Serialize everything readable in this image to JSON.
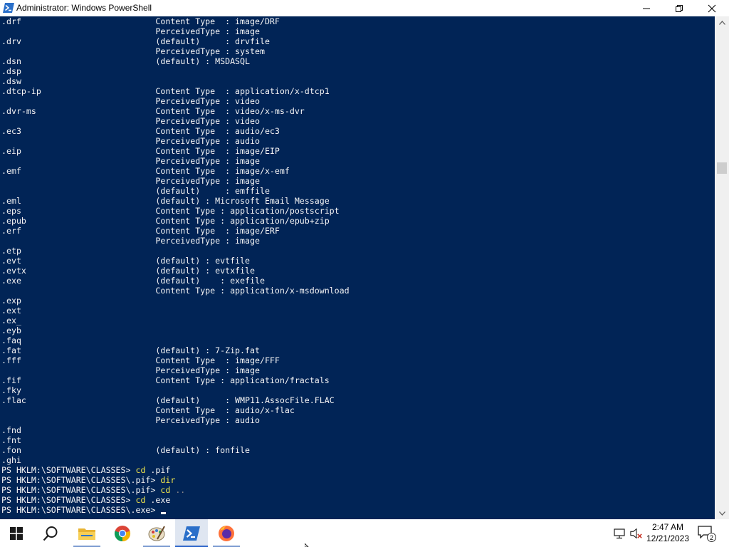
{
  "window": {
    "title": "Administrator: Windows PowerShell",
    "icon": "powershell-icon",
    "controls": [
      "minimize-icon",
      "restore-icon",
      "close-icon"
    ]
  },
  "console": {
    "output_lines": [
      ".drf                           Content Type  : image/DRF",
      "                               PerceivedType : image",
      ".drv                           (default)     : drvfile",
      "                               PerceivedType : system",
      ".dsn                           (default) : MSDASQL",
      ".dsp",
      ".dsw",
      ".dtcp-ip                       Content Type  : application/x-dtcp1",
      "                               PerceivedType : video",
      ".dvr-ms                        Content Type  : video/x-ms-dvr",
      "                               PerceivedType : video",
      ".ec3                           Content Type  : audio/ec3",
      "                               PerceivedType : audio",
      ".eip                           Content Type  : image/EIP",
      "                               PerceivedType : image",
      ".emf                           Content Type  : image/x-emf",
      "                               PerceivedType : image",
      "                               (default)     : emffile",
      ".eml                           (default) : Microsoft Email Message",
      ".eps                           Content Type : application/postscript",
      ".epub                          Content Type : application/epub+zip",
      ".erf                           Content Type  : image/ERF",
      "                               PerceivedType : image",
      ".etp",
      ".evt                           (default) : evtfile",
      ".evtx                          (default) : evtxfile",
      ".exe                           (default)    : exefile",
      "                               Content Type : application/x-msdownload",
      ".exp",
      ".ext",
      ".ex_",
      ".eyb",
      ".faq",
      ".fat                           (default) : 7-Zip.fat",
      ".fff                           Content Type  : image/FFF",
      "                               PerceivedType : image",
      ".fif                           Content Type : application/fractals",
      ".fky",
      ".flac                          (default)     : WMP11.AssocFile.FLAC",
      "                               Content Type  : audio/x-flac",
      "                               PerceivedType : audio",
      ".fnd",
      ".fnt",
      ".fon                           (default) : fonfile",
      ".ghi"
    ],
    "prompts": [
      {
        "path": "PS HKLM:\\SOFTWARE\\CLASSES> ",
        "cmd": "cd",
        "arg": " .pif",
        "arg_dim": ""
      },
      {
        "path": "PS HKLM:\\SOFTWARE\\CLASSES\\.pif> ",
        "cmd": "dir",
        "arg": "",
        "arg_dim": ""
      },
      {
        "path": "PS HKLM:\\SOFTWARE\\CLASSES\\.pif> ",
        "cmd": "cd",
        "arg": "",
        "arg_dim": " .."
      },
      {
        "path": "PS HKLM:\\SOFTWARE\\CLASSES> ",
        "cmd": "cd",
        "arg": " .exe",
        "arg_dim": ""
      },
      {
        "path": "PS HKLM:\\SOFTWARE\\CLASSES\\.exe> ",
        "cmd": "",
        "arg": "",
        "arg_dim": ""
      }
    ],
    "colors": {
      "background": "#012456",
      "text": "#f5f5f5",
      "command": "#f2e84b",
      "dim": "#8c8c8c"
    }
  },
  "taskbar": {
    "items": [
      {
        "name": "start-button",
        "icon": "windows-logo-icon"
      },
      {
        "name": "search-button",
        "icon": "search-icon"
      },
      {
        "name": "file-explorer",
        "icon": "folder-icon"
      },
      {
        "name": "chrome",
        "icon": "chrome-icon"
      },
      {
        "name": "paint",
        "icon": "paint-palette-icon"
      },
      {
        "name": "powershell",
        "icon": "powershell-icon"
      },
      {
        "name": "firefox",
        "icon": "firefox-icon"
      }
    ],
    "tray": {
      "network_icon": "network-icon",
      "volume_icon": "volume-muted-icon",
      "time": "2:47 AM",
      "date": "12/21/2023",
      "notification_count": "2"
    }
  }
}
